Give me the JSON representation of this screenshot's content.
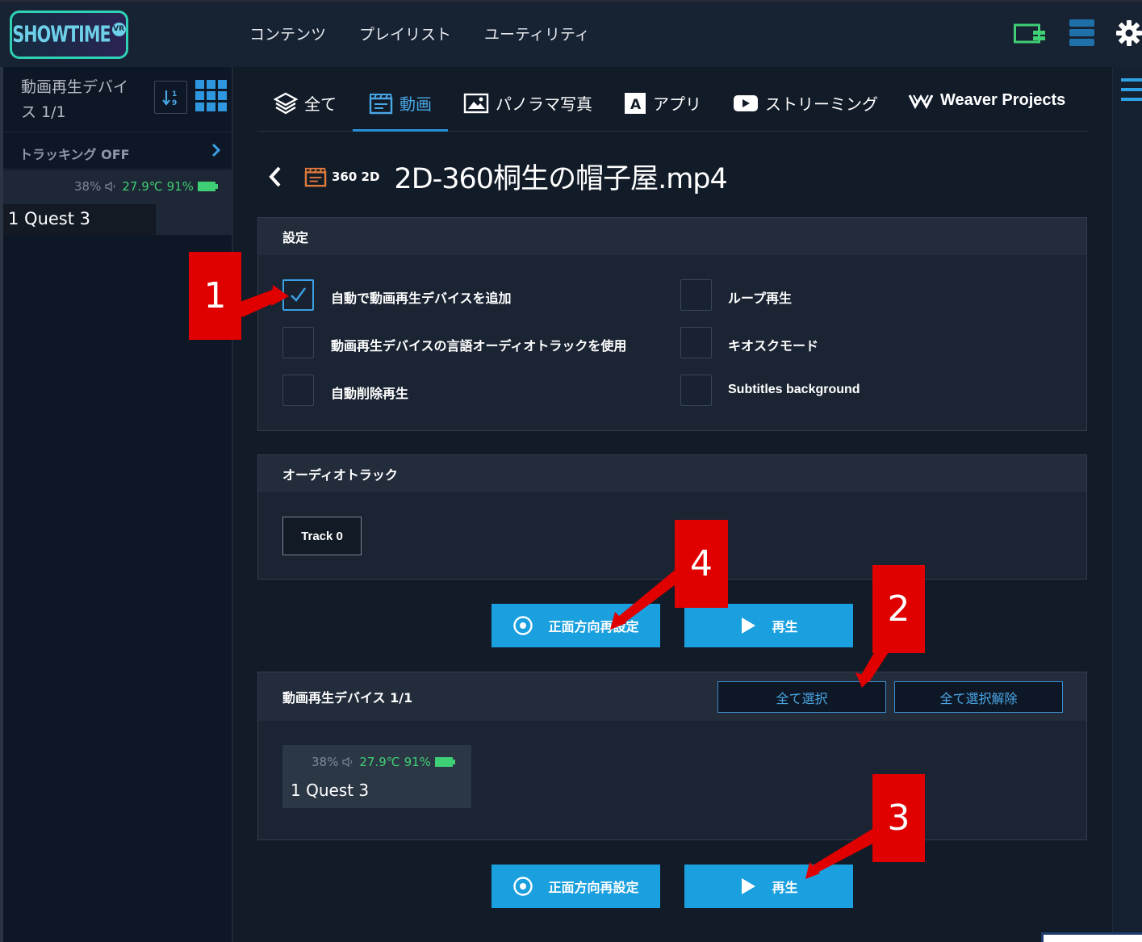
{
  "app": {
    "logo_text": "SHOWTIME",
    "logo_badge": "VR",
    "nav": [
      "コンテンツ",
      "プレイリスト",
      "ユーティリティ"
    ],
    "accent_color": "#1a9fdf"
  },
  "sidebar": {
    "heading": "動画再生デバイス 1/1",
    "tracking_label": "トラッキング OFF",
    "device": {
      "battery": "38%",
      "temperature": "27.9℃",
      "signal": "91%",
      "name": "1 Quest 3"
    }
  },
  "tabs": [
    {
      "label": "全て",
      "icon": "layers-icon"
    },
    {
      "label": "動画",
      "icon": "video-clapper-icon",
      "active": true
    },
    {
      "label": "パノラマ写真",
      "icon": "panorama-image-icon"
    },
    {
      "label": "アプリ",
      "icon": "app-a-icon"
    },
    {
      "label": "ストリーミング",
      "icon": "play-stream-icon"
    },
    {
      "label": "Weaver Projects",
      "icon": "weaver-w-icon"
    }
  ],
  "content": {
    "badge": "360 2D",
    "title": "2D-360桐生の帽子屋.mp4"
  },
  "settings": {
    "title": "設定",
    "options": [
      {
        "label": "自動で動画再生デバイスを追加",
        "checked": true
      },
      {
        "label": "ループ再生",
        "checked": false
      },
      {
        "label": "動画再生デバイスの言語オーディオトラックを使用",
        "checked": false
      },
      {
        "label": "キオスクモード",
        "checked": false
      },
      {
        "label": "自動削除再生",
        "checked": false
      },
      {
        "label": "Subtitles background",
        "checked": false
      }
    ]
  },
  "audio": {
    "title": "オーディオトラック",
    "track_label": "Track 0"
  },
  "actions": {
    "recenter_label": "正面方向再設定",
    "play_label": "再生"
  },
  "devices": {
    "title": "動画再生デバイス 1/1",
    "select_all": "全て選択",
    "deselect_all": "全て選択解除",
    "card": {
      "battery": "38%",
      "temperature": "27.9℃",
      "signal": "91%",
      "name": "1 Quest 3"
    }
  },
  "callouts": [
    "1",
    "2",
    "3",
    "4"
  ]
}
